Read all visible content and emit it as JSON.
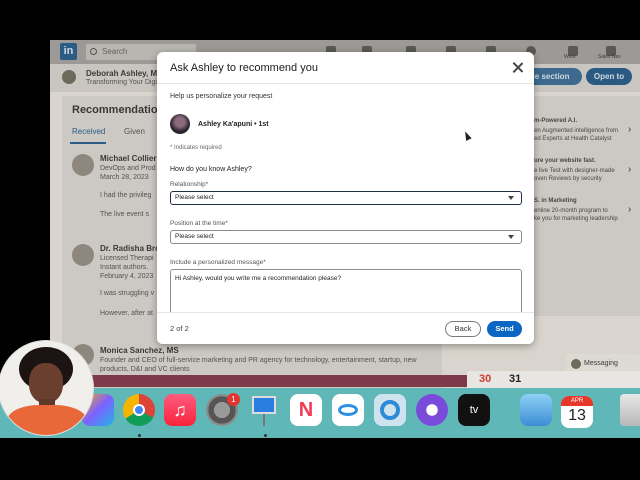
{
  "linkedin": {
    "search_placeholder": "Search",
    "profile": {
      "name": "Deborah Ashley, MS",
      "tagline": "Transforming Your Digital"
    },
    "buttons": {
      "add_section": "le section",
      "open_to": "Open to"
    },
    "nav_labels": {
      "work": "Work",
      "sales_nav": "Sales Nav"
    },
    "recommendations": {
      "title": "Recommendations",
      "tabs": [
        "Received",
        "Given"
      ],
      "items": [
        {
          "name": "Michael Collier",
          "lines": [
            "DevOps and Prod",
            "March 28, 2023",
            "I had the privileg",
            "The live event s"
          ]
        },
        {
          "name": "Dr. Radisha Bro",
          "lines": [
            "Licensed Therapi",
            "Instant authors.",
            "February 4, 2023",
            "I was struggling v",
            "However, after at"
          ]
        },
        {
          "name": "Monica Sanchez, MS",
          "lines": [
            "Founder and CEO of full-service marketing and PR agency for technology, entertainment, startup, new",
            "products, D&I and VC clients"
          ]
        }
      ]
    },
    "rail": [
      "m-Powered A.I.",
      "en Augmented intelligence from",
      "ed Experts at Health Catalyst",
      "ure your website fast.",
      "e live Test with designer-made",
      "oven Reviews by security",
      "S. in Marketing",
      "enline 20-month program to",
      "ke you for marketing leadership"
    ],
    "messaging": "Messaging"
  },
  "modal": {
    "title": "Ask Ashley to recommend you",
    "help_text": "Help us personalize your request",
    "person": "Ashley Ka'apuni • 1st",
    "required_note": "* Indicates required",
    "question": "How do you know Ashley?",
    "relationship_label": "Relationship*",
    "relationship_value": "Please select",
    "position_label": "Position at the time*",
    "position_value": "Please select",
    "message_label": "Include a personalized message*",
    "message_value": "Hi Ashley, would you write me a recommendation please?",
    "step": "2 of 2",
    "back": "Back",
    "send": "Send"
  },
  "desktop": {
    "calendar_days": [
      "30",
      "31"
    ],
    "dock": {
      "settings_badge": "1",
      "calendar_month": "APR",
      "calendar_day": "13",
      "apps": [
        "launchpad-icon",
        "chrome-icon",
        "music-icon",
        "system-settings-icon",
        "keynote-icon",
        "news-icon",
        "freeform-icon",
        "quicktime-icon",
        "flower-app-icon",
        "apple-tv-icon",
        "preview-icon",
        "calendar-icon",
        "trash-icon"
      ]
    }
  },
  "colors": {
    "linkedin_blue": "#0a66c2",
    "dock_bg": "#5fb7b7",
    "badge_red": "#e3342f"
  }
}
